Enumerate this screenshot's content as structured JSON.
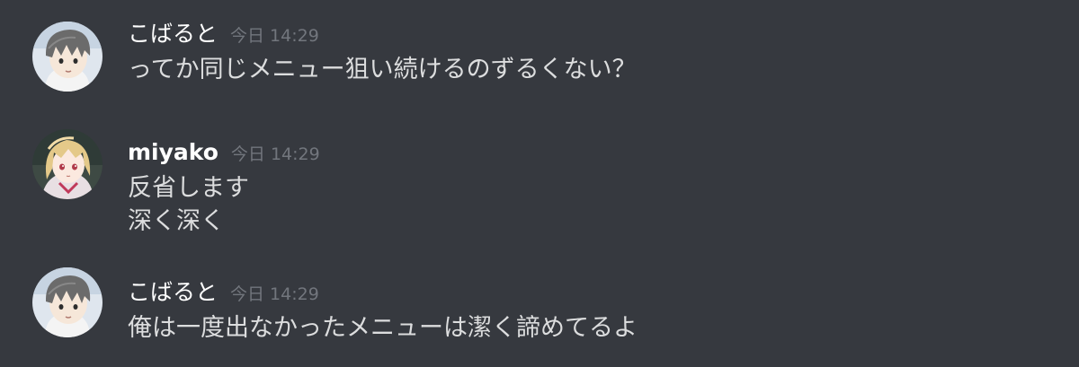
{
  "messages": [
    {
      "username": "こばると",
      "timestamp": "今日 14:29",
      "lines": [
        "ってか同じメニュー狙い続けるのずるくない？"
      ]
    },
    {
      "username": "miyako",
      "timestamp": "今日 14:29",
      "lines": [
        "反省します",
        "深く深く"
      ]
    },
    {
      "username": "こばると",
      "timestamp": "今日 14:29",
      "lines": [
        "俺は一度出なかったメニューは潔く諦めてるよ"
      ]
    }
  ],
  "colors": {
    "background": "#36393f",
    "username": "#ffffff",
    "timestamp": "#72767d",
    "message_text": "#dcddde"
  },
  "icons": {
    "avatar_kobaruto": "gray-haired-anime-boy-avatar",
    "avatar_miyako": "blonde-anime-girl-avatar"
  }
}
